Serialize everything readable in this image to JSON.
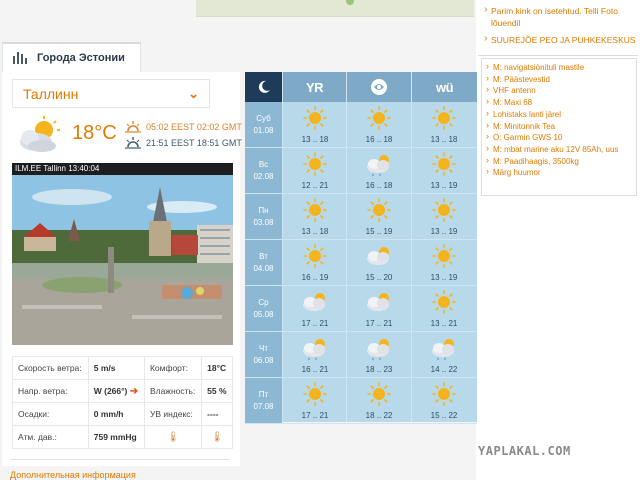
{
  "tab": {
    "label": "Города Эстонии",
    "icon": "buildings-icon"
  },
  "city_select": {
    "value": "Таллинн"
  },
  "current": {
    "temperature": "18°C",
    "icon": "partly-cloudy-icon",
    "sunrise": "05:02 EEST 02:02 GMT",
    "sunset": "21:51 EEST 18:51 GMT"
  },
  "webcam": {
    "title": "ILM.EE Tallinn  13:40:04"
  },
  "stats": {
    "wind_speed_label": "Скорость ветра:",
    "wind_speed": "5 m/s",
    "comfort_label": "Комфорт:",
    "comfort": "18°C",
    "wind_dir_label": "Напр. ветра:",
    "wind_dir": "W (266°)",
    "humidity_label": "Влажность:",
    "humidity": "55 %",
    "precip_label": "Осадки:",
    "precip": "0 mm/h",
    "uv_label": "УВ индекс:",
    "uv": "----",
    "pressure_label": "Атм. дав.:",
    "pressure": "759 mmHg"
  },
  "more_info": "Дополнительная информация",
  "forecast": {
    "sources": [
      {
        "label": "",
        "icon": "moon-icon",
        "active": true
      },
      {
        "label": "YR",
        "icon": "yr-logo-icon",
        "active": false
      },
      {
        "label": "",
        "icon": "globe-logo-icon",
        "active": false
      },
      {
        "label": "wü",
        "icon": "wu-logo-icon",
        "active": false
      }
    ],
    "days": [
      {
        "day": "Суб",
        "date": "01.08",
        "cells": [
          {
            "icon": "sun",
            "temps": "13 .. 18"
          },
          {
            "icon": "sun",
            "temps": "16 .. 18"
          },
          {
            "icon": "sun",
            "temps": "13 .. 18"
          }
        ]
      },
      {
        "day": "Вс",
        "date": "02.08",
        "cells": [
          {
            "icon": "sun",
            "temps": "12 .. 21"
          },
          {
            "icon": "cloud-rain",
            "temps": "16 .. 18"
          },
          {
            "icon": "sun",
            "temps": "13 .. 19"
          }
        ]
      },
      {
        "day": "Пн",
        "date": "03.08",
        "cells": [
          {
            "icon": "sun",
            "temps": "13 .. 18"
          },
          {
            "icon": "sun",
            "temps": "15 .. 19"
          },
          {
            "icon": "sun",
            "temps": "13 .. 19"
          }
        ]
      },
      {
        "day": "Вт",
        "date": "04.08",
        "cells": [
          {
            "icon": "sun",
            "temps": "16 .. 19"
          },
          {
            "icon": "sun-cloud",
            "temps": "15 .. 20"
          },
          {
            "icon": "sun",
            "temps": "13 .. 19"
          }
        ]
      },
      {
        "day": "Ср",
        "date": "05.08",
        "cells": [
          {
            "icon": "sun-cloud",
            "temps": "17 .. 21"
          },
          {
            "icon": "sun-cloud",
            "temps": "17 .. 21"
          },
          {
            "icon": "sun",
            "temps": "13 .. 21"
          }
        ]
      },
      {
        "day": "Чт",
        "date": "06.08",
        "cells": [
          {
            "icon": "cloud-rain",
            "temps": "16 .. 21"
          },
          {
            "icon": "cloud-rain",
            "temps": "18 .. 23"
          },
          {
            "icon": "cloud-rain",
            "temps": "14 .. 22"
          }
        ]
      },
      {
        "day": "Пт",
        "date": "07.08",
        "cells": [
          {
            "icon": "sun",
            "temps": "17 .. 21"
          },
          {
            "icon": "sun",
            "temps": "18 .. 22"
          },
          {
            "icon": "sun",
            "temps": "15 .. 22"
          }
        ]
      }
    ]
  },
  "news": [
    "Parim kink on isetehtud. Telli Foto lõuendil",
    "SUUREJÕE PEO JA PUHKEKESKUS"
  ],
  "ads": [
    "M: navigatsiònituli mastile",
    "M: Päästevestid",
    "VHF antenn",
    "M: Maxi 68",
    "Lohistaks lanti järel",
    "M: Minitonnik Tea",
    "O: Garmin GWS 10",
    "M: mbat marine aku 12V 85Ah, uus",
    "M: Paadihaagis, 3500kg",
    "Märg huumor"
  ],
  "watermark": "YAPLAKAL.COM",
  "colors": {
    "accent": "#e07b00",
    "forecast_bg": "#b7d9ea",
    "forecast_header": "#7eaac7",
    "forecast_active": "#1e3c5a"
  }
}
